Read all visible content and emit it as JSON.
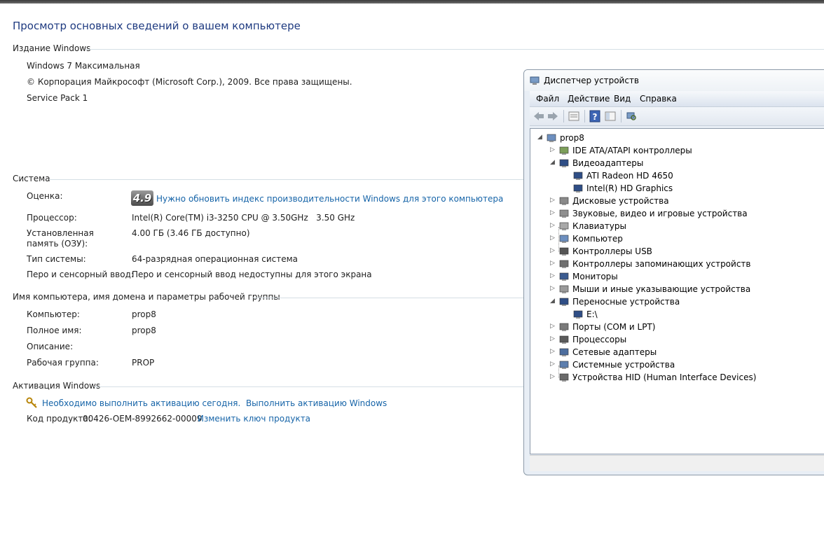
{
  "header": {
    "title": "Просмотр основных сведений о вашем компьютере"
  },
  "edition": {
    "heading": "Издание Windows",
    "name": "Windows 7 Максимальная",
    "copyright": "© Корпорация Майкрософт (Microsoft Corp.), 2009. Все права защищены.",
    "service_pack": "Service Pack 1"
  },
  "system": {
    "heading": "Система",
    "rating_label": "Оценка:",
    "rating_value": "4.9",
    "rating_link": "Нужно обновить индекс производительности Windows для этого компьютера",
    "cpu_label": "Процессор:",
    "cpu_value": "Intel(R) Core(TM) i3-3250 CPU @ 3.50GHz   3.50 GHz",
    "ram_label": "Установленная память (ОЗУ):",
    "ram_value": "4.00 ГБ (3.46 ГБ доступно)",
    "type_label": "Тип системы:",
    "type_value": "64-разрядная операционная система",
    "pen_label": "Перо и сенсорный ввод:",
    "pen_value": "Перо и сенсорный ввод недоступны для этого экрана"
  },
  "computer": {
    "heading": "Имя компьютера, имя домена и параметры рабочей группы",
    "name_label": "Компьютер:",
    "name_value": "prop8",
    "fullname_label": "Полное имя:",
    "fullname_value": "prop8",
    "description_label": "Описание:",
    "description_value": "",
    "workgroup_label": "Рабочая группа:",
    "workgroup_value": "PROP"
  },
  "activation": {
    "heading": "Активация Windows",
    "link": "Необходимо выполнить активацию сегодня.  Выполнить активацию Windows",
    "key_label": "Код продукта:",
    "key_value": "00426-OEM-8992662-00009",
    "change_key_link": "Изменить ключ продукта"
  },
  "device_manager": {
    "title": "Диспетчер устройств",
    "menu": [
      "Файл",
      "Действие",
      "Вид",
      "Справка"
    ],
    "toolbar_icons": [
      "back-arrow-icon",
      "forward-arrow-icon",
      "properties-icon",
      "help-icon",
      "view-icon",
      "scan-hardware-icon"
    ],
    "tree": [
      {
        "label": "prop8",
        "level": 0,
        "expanded": true,
        "icon": "computer-icon"
      },
      {
        "label": "IDE ATA/ATAPI контроллеры",
        "level": 1,
        "expanded": false,
        "icon": "ide-controller-icon"
      },
      {
        "label": "Видеоадаптеры",
        "level": 1,
        "expanded": true,
        "icon": "display-adapter-icon"
      },
      {
        "label": "ATI Radeon HD 4650",
        "level": 2,
        "icon": "display-adapter-icon"
      },
      {
        "label": "Intel(R) HD Graphics",
        "level": 2,
        "icon": "display-adapter-icon"
      },
      {
        "label": "Дисковые устройства",
        "level": 1,
        "expanded": false,
        "icon": "disk-drive-icon"
      },
      {
        "label": "Звуковые, видео и игровые устройства",
        "level": 1,
        "expanded": false,
        "icon": "sound-icon"
      },
      {
        "label": "Клавиатуры",
        "level": 1,
        "expanded": false,
        "icon": "keyboard-icon"
      },
      {
        "label": "Компьютер",
        "level": 1,
        "expanded": false,
        "icon": "computer-icon"
      },
      {
        "label": "Контроллеры USB",
        "level": 1,
        "expanded": false,
        "icon": "usb-icon"
      },
      {
        "label": "Контроллеры запоминающих устройств",
        "level": 1,
        "expanded": false,
        "icon": "storage-controller-icon"
      },
      {
        "label": "Мониторы",
        "level": 1,
        "expanded": false,
        "icon": "monitor-icon"
      },
      {
        "label": "Мыши и иные указывающие устройства",
        "level": 1,
        "expanded": false,
        "icon": "mouse-icon"
      },
      {
        "label": "Переносные устройства",
        "level": 1,
        "expanded": true,
        "icon": "portable-device-icon"
      },
      {
        "label": "E:\\",
        "level": 2,
        "icon": "portable-device-icon"
      },
      {
        "label": "Порты (COM и LPT)",
        "level": 1,
        "expanded": false,
        "icon": "port-icon"
      },
      {
        "label": "Процессоры",
        "level": 1,
        "expanded": false,
        "icon": "processor-icon"
      },
      {
        "label": "Сетевые адаптеры",
        "level": 1,
        "expanded": false,
        "icon": "network-adapter-icon"
      },
      {
        "label": "Системные устройства",
        "level": 1,
        "expanded": false,
        "icon": "system-device-icon"
      },
      {
        "label": "Устройства HID (Human Interface Devices)",
        "level": 1,
        "expanded": false,
        "icon": "hid-icon"
      }
    ]
  },
  "colors": {
    "link": "#1664a8",
    "title": "#1e3a80"
  }
}
